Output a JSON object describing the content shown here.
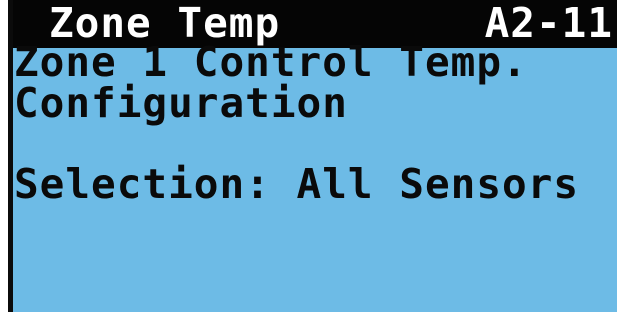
{
  "header": {
    "title": "Zone Temp",
    "screen_id": "A2-11"
  },
  "body": {
    "line1": "Zone 1 Control Temp.",
    "line2": "Configuration",
    "selection": "Selection: All Sensors"
  },
  "colors": {
    "lcd_background": "#6dbbe6",
    "title_bar": "#050505",
    "title_text": "#ffffff",
    "body_text": "#0a0a0a"
  }
}
